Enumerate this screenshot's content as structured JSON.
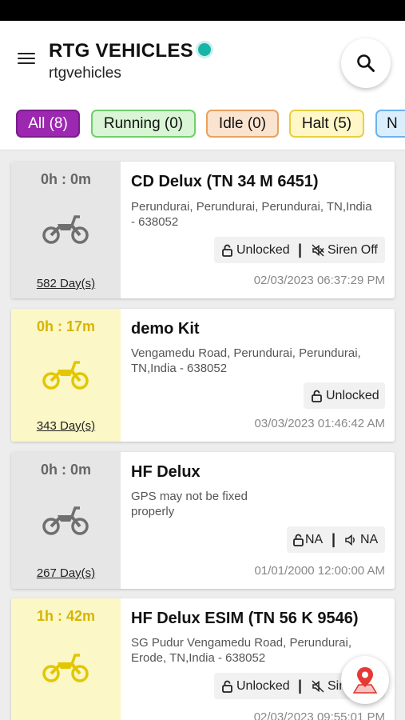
{
  "app": {
    "title": "RTG VEHICLES",
    "subtitle": "rtgvehicles",
    "status_color": "#17b5a8"
  },
  "filters": [
    {
      "label": "All (8)",
      "active": true
    },
    {
      "label": "Running (0)"
    },
    {
      "label": "Idle (0)"
    },
    {
      "label": "Halt (5)"
    },
    {
      "label": "N"
    }
  ],
  "vehicles": [
    {
      "duration": "0h : 0m",
      "status": "halt-grey",
      "name": "CD Delux (TN 34 M 6451)",
      "address": "Perundurai, Perundurai, Perundurai, TN,India - 638052",
      "lock": "Unlocked",
      "siren": "Siren Off",
      "days": "582 Day(s)",
      "timestamp": "02/03/2023 06:37:29 PM"
    },
    {
      "duration": "0h : 17m",
      "status": "yellow",
      "name": "demo Kit",
      "address": "Vengamedu Road, Perundurai, Perundurai, TN,India - 638052",
      "lock": "Unlocked",
      "days": "343 Day(s)",
      "timestamp": "03/03/2023 01:46:42 AM"
    },
    {
      "duration": "0h : 0m",
      "status": "halt-grey",
      "name": "HF Delux",
      "address": "GPS may not be fixed properly",
      "lock": "NA",
      "siren": "NA",
      "days": "267 Day(s)",
      "timestamp": "01/01/2000 12:00:00 AM"
    },
    {
      "duration": "1h : 42m",
      "status": "yellow",
      "name": "HF Delux ESIM (TN 56 K 9546)",
      "address": "SG Pudur Vengamedu Road, Perundurai, Erode, TN,India - 638052",
      "lock": "Unlocked",
      "siren": "Sir",
      "timestamp": "02/03/2023 09:55:01 PM"
    }
  ]
}
